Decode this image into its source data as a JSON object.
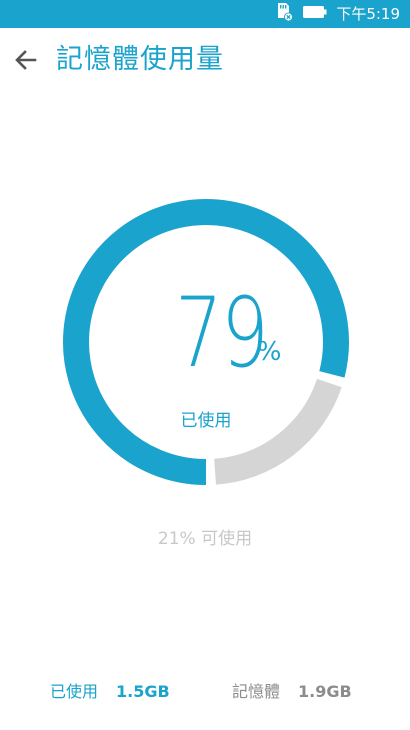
{
  "status_bar": {
    "time": "下午5:19",
    "icons": [
      "sd-card-icon",
      "battery-icon"
    ],
    "color": "#1aa3cc"
  },
  "header": {
    "title": "記憶體使用量",
    "back_icon": "arrow-left-icon"
  },
  "gauge": {
    "used_percent": 79,
    "percent_value": "79",
    "percent_sign": "%",
    "used_label": "已使用",
    "available_text": "21% 可使用",
    "used_color": "#1aa3cc",
    "free_color": "#d5d5d5"
  },
  "stats": {
    "used_label": "已使用",
    "used_value": "1.5GB",
    "total_label": "記憶體",
    "total_value": "1.9GB"
  }
}
